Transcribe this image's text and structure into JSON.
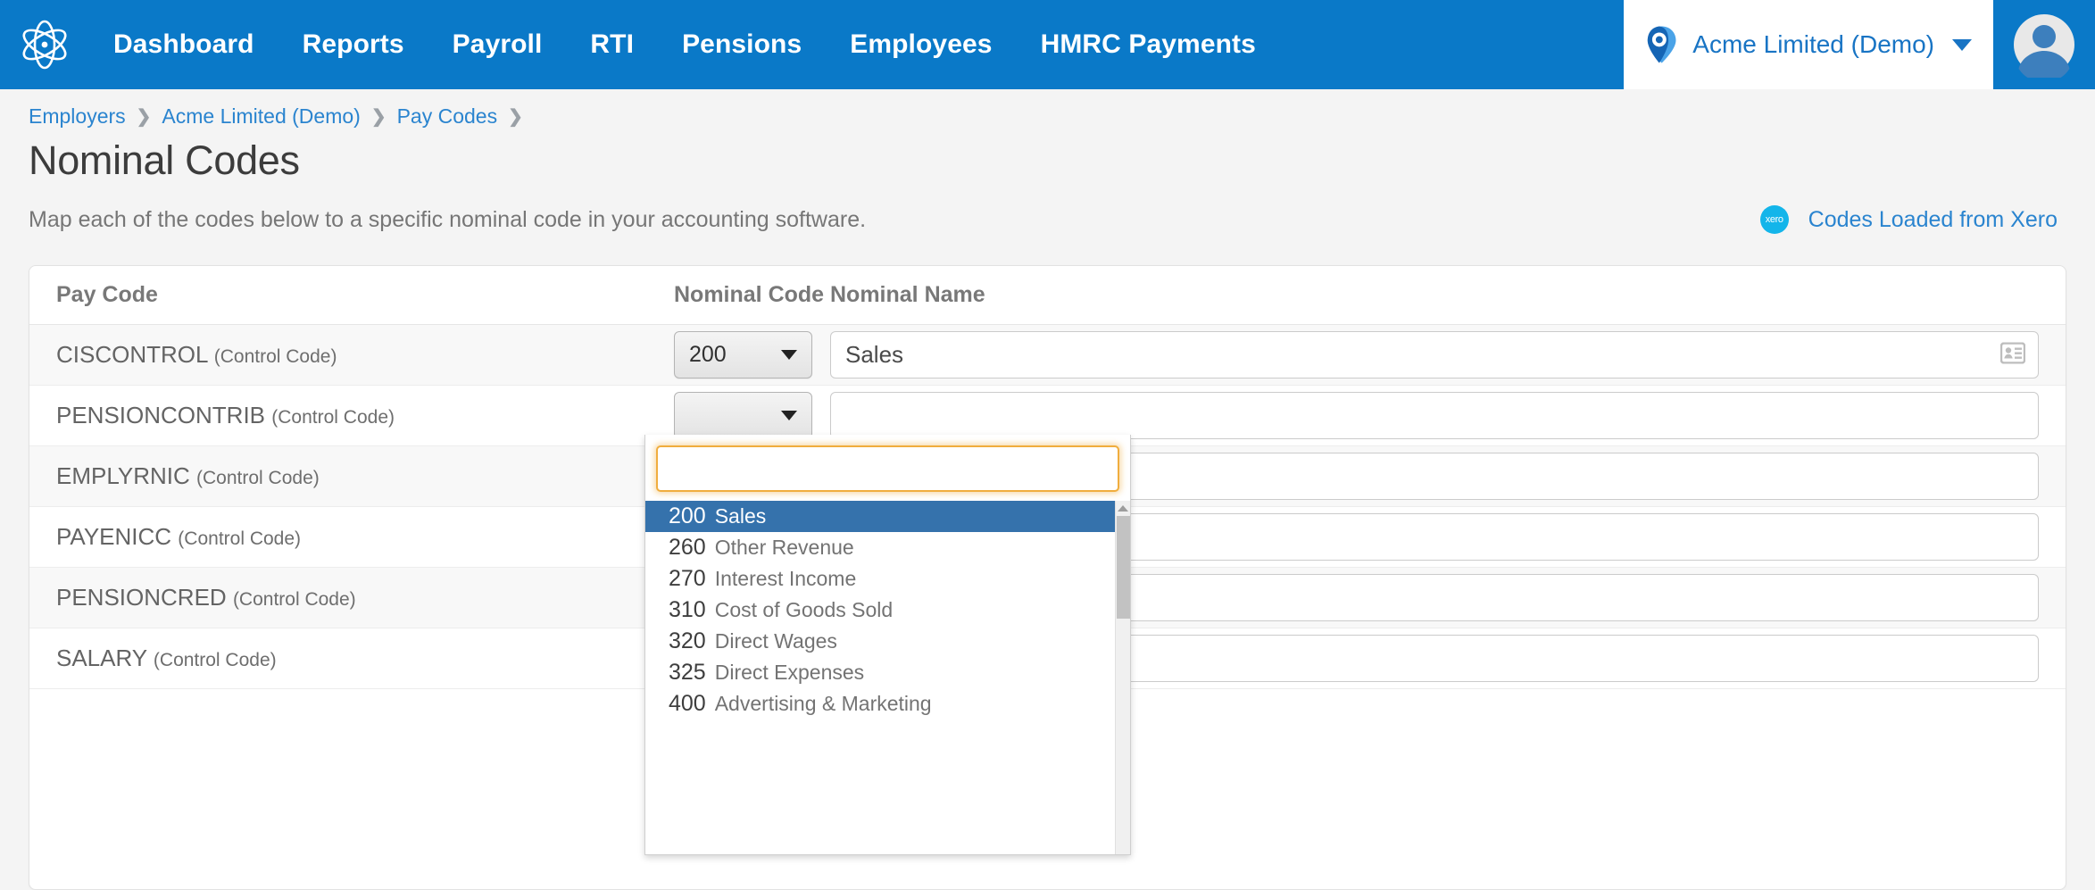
{
  "nav": {
    "logo_icon": "atom-logo-icon",
    "links": [
      {
        "label": "Dashboard"
      },
      {
        "label": "Reports"
      },
      {
        "label": "Payroll"
      },
      {
        "label": "RTI"
      },
      {
        "label": "Pensions"
      },
      {
        "label": "Employees"
      },
      {
        "label": "HMRC Payments"
      }
    ],
    "company": {
      "icon": "location-pin-icon",
      "name": "Acme Limited (Demo)",
      "caret_icon": "chevron-down-icon"
    },
    "avatar_icon": "user-avatar-icon",
    "bg_color": "#0a79c8"
  },
  "breadcrumb": {
    "items": [
      {
        "label": "Employers"
      },
      {
        "label": "Acme Limited (Demo)"
      },
      {
        "label": "Pay Codes"
      }
    ],
    "separator": "❯"
  },
  "page": {
    "title": "Nominal Codes",
    "subtitle": "Map each of the codes below to a specific nominal code in your accounting software.",
    "xero": {
      "logo_text": "xero",
      "link_label": "Codes Loaded from Xero",
      "logo_color": "#13b5ea",
      "link_color": "#2a84cf"
    }
  },
  "table": {
    "headers": {
      "pay_code": "Pay Code",
      "nominal_code": "Nominal Code",
      "nominal_name": "Nominal Name"
    },
    "rows": [
      {
        "pay_code": "CISCONTROL",
        "pay_code_suffix": "(Control Code)",
        "nominal_code": "200",
        "nominal_name": "Sales",
        "name_icon": "contact-card-icon"
      },
      {
        "pay_code": "PENSIONCONTRIB",
        "pay_code_suffix": "(Control Code)",
        "nominal_code": "",
        "nominal_name": "",
        "name_icon": "contact-card-icon"
      },
      {
        "pay_code": "EMPLYRNIC",
        "pay_code_suffix": "(Control Code)",
        "nominal_code": "",
        "nominal_name": "",
        "name_icon": "contact-card-icon"
      },
      {
        "pay_code": "PAYENICC",
        "pay_code_suffix": "(Control Code)",
        "nominal_code": "",
        "nominal_name": "",
        "name_icon": "contact-card-icon"
      },
      {
        "pay_code": "PENSIONCRED",
        "pay_code_suffix": "(Control Code)",
        "nominal_code": "",
        "nominal_name": "",
        "name_icon": "contact-card-icon"
      },
      {
        "pay_code": "SALARY",
        "pay_code_suffix": "(Control Code)",
        "nominal_code": "",
        "nominal_name": "",
        "name_icon": "contact-card-icon"
      }
    ]
  },
  "dropdown": {
    "open": true,
    "search_value": "",
    "search_placeholder": "",
    "selected_code": "200",
    "focus_color": "#f0ad3e",
    "highlight_color": "#3572ac",
    "options": [
      {
        "code": "200",
        "name": "Sales",
        "selected": true
      },
      {
        "code": "260",
        "name": "Other Revenue",
        "selected": false
      },
      {
        "code": "270",
        "name": "Interest Income",
        "selected": false
      },
      {
        "code": "310",
        "name": "Cost of Goods Sold",
        "selected": false
      },
      {
        "code": "320",
        "name": "Direct Wages",
        "selected": false
      },
      {
        "code": "325",
        "name": "Direct Expenses",
        "selected": false
      },
      {
        "code": "400",
        "name": "Advertising & Marketing",
        "selected": false
      }
    ],
    "scrollbar": {
      "up_arrow_icon": "scroll-up-arrow-icon"
    }
  }
}
